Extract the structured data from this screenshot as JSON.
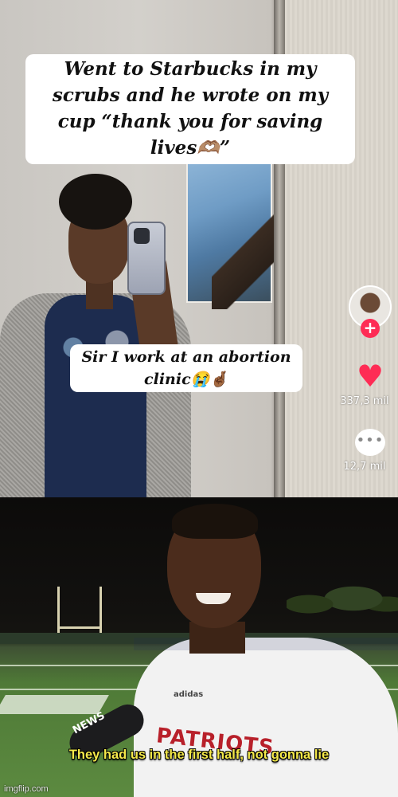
{
  "top_panel": {
    "caption_1": {
      "line_1": "Went to Starbucks in my",
      "line_2": "scrubs and he wrote on my",
      "line_3": "cup “thank you for saving",
      "line_4": "lives🫶🏽”"
    },
    "caption_2": {
      "line_1": "Sir I work at an abortion",
      "line_2": "clinic😭🤞🏾"
    },
    "follow_symbol": "+",
    "heart_symbol": "♥",
    "like_count": "337,3 mil",
    "comment_symbol": "•••",
    "comment_count": "12,7 mil",
    "colors": {
      "accent": "#fe2c55"
    }
  },
  "bottom_panel": {
    "jersey_text": "PATRIOTS",
    "jersey_brand": "adidas",
    "mic_logo": "NEWS",
    "subtitle": "They had us in the first half, not gonna lie",
    "subtitle_color": "#f5e94a"
  },
  "watermark": "imgflip.com"
}
